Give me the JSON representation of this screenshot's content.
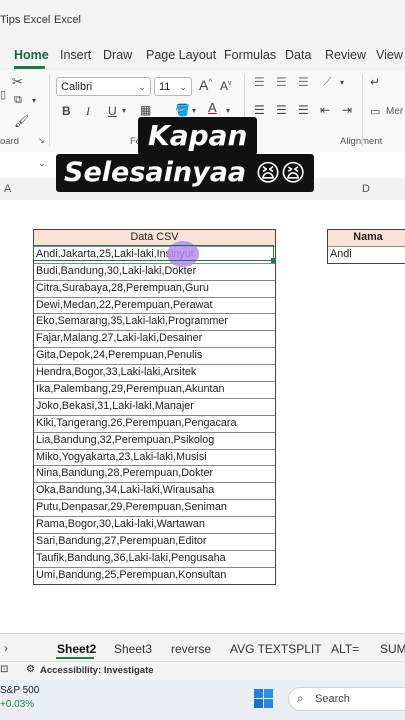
{
  "window": {
    "title_left": "Tips Excel",
    "separator": "-",
    "app_name": "Excel"
  },
  "ribbon_tabs": [
    "Home",
    "Insert",
    "Draw",
    "Page Layout",
    "Formulas",
    "Data",
    "Review",
    "View"
  ],
  "ribbon": {
    "font_name": "Calibri",
    "font_size": "11",
    "grow_font": "A",
    "shrink_font": "A",
    "bold": "B",
    "italic": "I",
    "underline": "U",
    "font_color_letter": "A",
    "clipboard_label": "oard",
    "font_label": "Fo",
    "alignment_label": "Alignment",
    "merge_label": "Mer"
  },
  "column_letters": {
    "a": "A",
    "d": "D"
  },
  "overlay": {
    "line1": "Kapan",
    "line2": "Selesainyaa",
    "emoji": "😫😫"
  },
  "csv": {
    "header": "Data CSV",
    "rows": [
      "Andi,Jakarta,25,Laki-laki,Insinyur",
      "Budi,Bandung,30,Laki-laki,Dokter",
      "Citra,Surabaya,28,Perempuan,Guru",
      "Dewi,Medan,22,Perempuan,Perawat",
      "Eko,Semarang,35,Laki-laki,Programmer",
      "Fajar,Malang,27,Laki-laki,Desainer",
      "Gita,Depok,24,Perempuan,Penulis",
      "Hendra,Bogor,33,Laki-laki,Arsitek",
      "Ika,Palembang,29,Perempuan,Akuntan",
      "Joko,Bekasi,31,Laki-laki,Manajer",
      "Kiki,Tangerang,26,Perempuan,Pengacara",
      "Lia,Bandung,32,Perempuan,Psikolog",
      "Miko,Yogyakarta,23,Laki-laki,Musisi",
      "Nina,Bandung,28,Perempuan,Dokter",
      "Oka,Bandung,34,Laki-laki,Wirausaha",
      "Putu,Denpasar,29,Perempuan,Seniman",
      "Rama,Bogor,30,Laki-laki,Wartawan",
      "Sari,Bandung,27,Perempuan,Editor",
      "Taufik,Bandung,36,Laki-laki,Pengusaha",
      "Umi,Bandung,25,Perempuan,Konsultan"
    ]
  },
  "nama": {
    "header": "Nama",
    "first_value": "Andi"
  },
  "sheet_tabs": [
    "Sheet2",
    "Sheet3",
    "reverse",
    "AVG TEXTSPLIT",
    "ALT=",
    "SUM"
  ],
  "status": {
    "accessibility": "Accessibility: Investigate"
  },
  "taskbar": {
    "stock_name": "S&P 500",
    "stock_change": "+0.03%",
    "search_placeholder": "Search"
  },
  "colors": {
    "accent": "#1a7a43",
    "csv_header_bg": "#fbe2d5",
    "nama_header_bg": "#fbe2d5",
    "highlight": "#b48cf0",
    "stock_change": "#1a8f3c"
  }
}
